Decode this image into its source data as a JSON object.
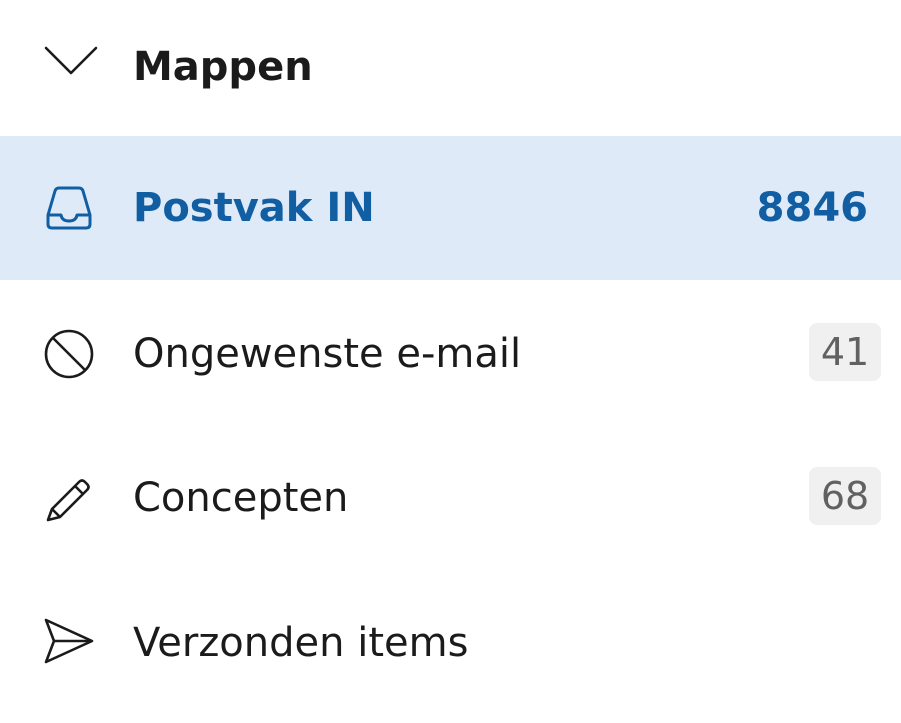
{
  "header": {
    "title": "Mappen",
    "chevron_icon": "chevron-down-icon"
  },
  "folders": [
    {
      "label": "Postvak IN",
      "count": "8846",
      "icon": "inbox-icon",
      "selected": true
    },
    {
      "label": "Ongewenste e-mail",
      "count": "41",
      "icon": "prohibited-icon",
      "selected": false
    },
    {
      "label": "Concepten",
      "count": "68",
      "icon": "pencil-icon",
      "selected": false
    },
    {
      "label": "Verzonden items",
      "count": "",
      "icon": "send-icon",
      "selected": false
    }
  ],
  "colors": {
    "accent": "#115ea3",
    "selected_background": "#deeaf8",
    "badge_background": "#f0f0f0",
    "badge_text": "#616161",
    "text": "#1b1b1b"
  }
}
